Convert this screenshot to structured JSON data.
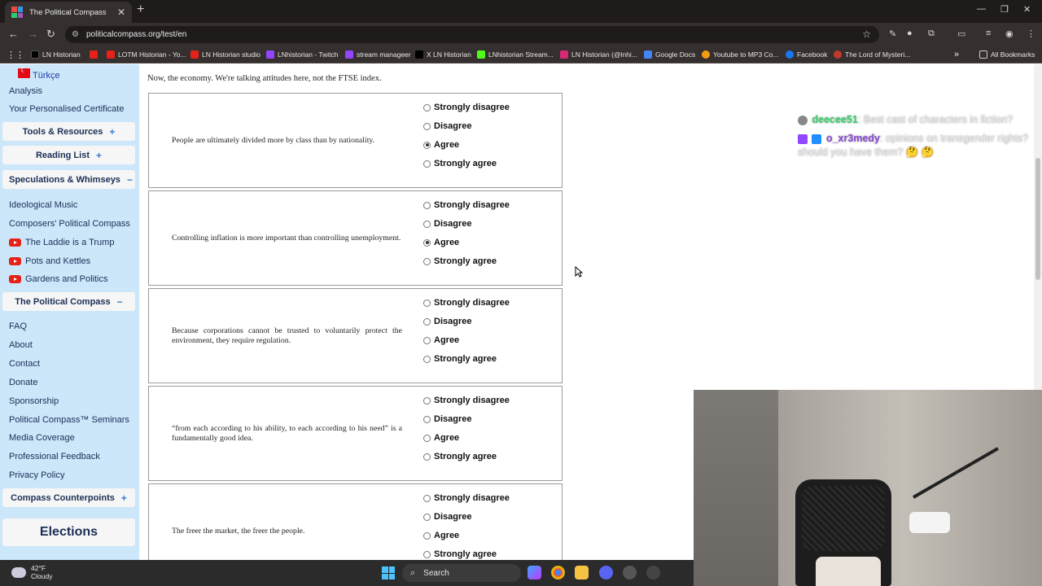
{
  "browser": {
    "tab_title": "The Political Compass",
    "url": "politicalcompass.org/test/en",
    "bookmarks": [
      "LN Historian",
      "LOTM Historian - Yo...",
      "LN Historian studio",
      "LNhistorian - Twitch",
      "stream manageer",
      "X LN Historian",
      "LNhistorian Stream...",
      "LN Historian (@lnhi...",
      "Google Docs",
      "Youtube to MP3 Co...",
      "Facebook",
      "The Lord of Mysteri..."
    ],
    "all_bookmarks": "All Bookmarks"
  },
  "sidebar": {
    "lang": "Türkçe",
    "analysis": "Analysis",
    "certificate": "Your Personalised Certificate",
    "tools": "Tools & Resources",
    "reading": "Reading List",
    "speculations": "Speculations & Whimseys",
    "ideological_music": "Ideological Music",
    "composers": "Composers' Political Compass",
    "yt_items": [
      "The Laddie is a Trump",
      "Pots and Kettles",
      "Gardens and Politics"
    ],
    "political_compass": "The Political Compass",
    "links": [
      "FAQ",
      "About",
      "Contact",
      "Donate",
      "Sponsorship",
      "Political Compass™ Seminars",
      "Media Coverage",
      "Professional Feedback",
      "Privacy Policy"
    ],
    "counterpoints": "Compass Counterpoints",
    "elections": "Elections",
    "plus": "+",
    "minus": "−"
  },
  "main": {
    "intro": "Now, the economy. We're talking attitudes here, not the FTSE index.",
    "options": [
      "Strongly disagree",
      "Disagree",
      "Agree",
      "Strongly agree"
    ],
    "questions": [
      {
        "text": "People are ultimately divided more by class than by nationality.",
        "selected": "Agree"
      },
      {
        "text": "Controlling inflation is more important than controlling unemployment.",
        "selected": "Agree"
      },
      {
        "text": "Because corporations cannot be trusted to voluntarily protect the environment, they require regulation.",
        "selected": ""
      },
      {
        "text": "“from each according to his ability, to each according to his need” is a fundamentally good idea.",
        "selected": ""
      },
      {
        "text": "The freer the market, the freer the people.",
        "selected": ""
      }
    ]
  },
  "chat": {
    "user1": "deecee51",
    "msg1": "Best cast of characters in fiction?",
    "user2": "o_xr3medy",
    "msg2": "opinions on transgender rights? should you have them? 🤔 🤔",
    "colors": {
      "user1": "#36d36c",
      "user2": "#8c4bd6"
    }
  },
  "taskbar": {
    "temp": "42°F",
    "condition": "Cloudy",
    "search": "Search"
  }
}
